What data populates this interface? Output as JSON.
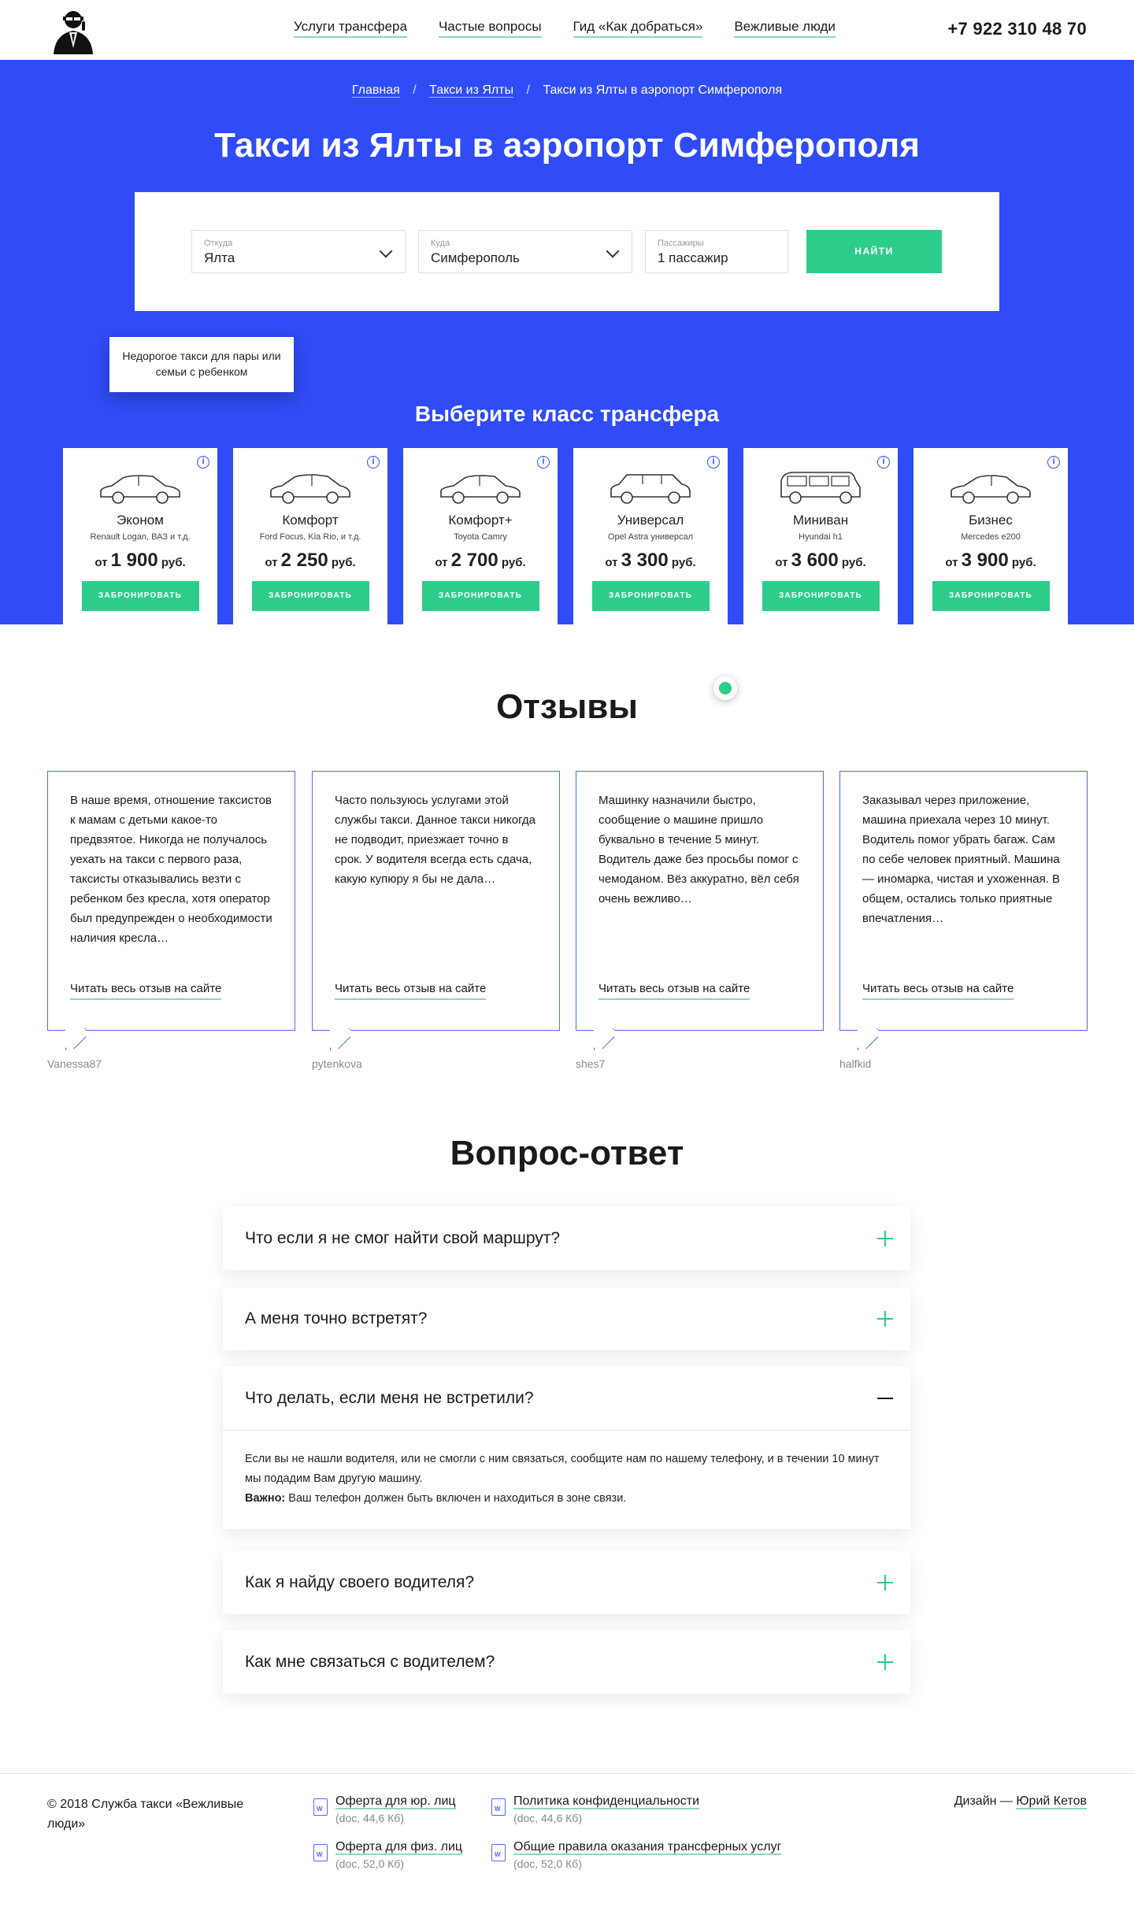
{
  "header": {
    "nav": [
      "Услуги трансфера",
      "Частые вопросы",
      "Гид «Как добраться»",
      "Вежливые люди"
    ],
    "phone": "+7 922 310 48 70"
  },
  "breadcrumbs": [
    "Главная",
    "Такси из Ялты",
    "Такси из Ялты в аэропорт Симферополя"
  ],
  "hero": {
    "title": "Такси из Ялты в аэропорт Симферополя",
    "from_label": "Откуда",
    "from_value": "Ялта",
    "to_label": "Куда",
    "to_value": "Симферополь",
    "pass_label": "Пассажиры",
    "pass_value": "1 пассажир",
    "find_button": "НАЙТИ"
  },
  "tooltip": "Недорогое такси для пары или семьи с ребенком",
  "classes_title": "Выберите класс трансфера",
  "classes": [
    {
      "name": "Эконом",
      "models": "Renault Logan, ВАЗ и т.д.",
      "price_prefix": "от",
      "price": "1 900",
      "currency": "руб.",
      "button": "ЗАБРОНИРОВАТЬ"
    },
    {
      "name": "Комфорт",
      "models": "Ford Focus, Kia Rio, и т.д.",
      "price_prefix": "от",
      "price": "2 250",
      "currency": "руб.",
      "button": "ЗАБРОНИРОВАТЬ"
    },
    {
      "name": "Комфорт+",
      "models": "Toyota Camry",
      "price_prefix": "от",
      "price": "2 700",
      "currency": "руб.",
      "button": "ЗАБРОНИРОВАТЬ"
    },
    {
      "name": "Универсал",
      "models": "Opel Astra универсал",
      "price_prefix": "от",
      "price": "3 300",
      "currency": "руб.",
      "button": "ЗАБРОНИРОВАТЬ"
    },
    {
      "name": "Миниван",
      "models": "Hyundai h1",
      "price_prefix": "от",
      "price": "3 600",
      "currency": "руб.",
      "button": "ЗАБРОНИРОВАТЬ"
    },
    {
      "name": "Бизнес",
      "models": "Mercedes e200",
      "price_prefix": "от",
      "price": "3 900",
      "currency": "руб.",
      "button": "ЗАБРОНИРОВАТЬ"
    }
  ],
  "reviews_title": "Отзывы",
  "reviews": [
    {
      "text": "В наше время, отношение таксистов к мамам с детьми какое-то предвзятое. Никогда не получалось уехать на такси с первого раза, таксисты отказывались везти с ребенком без кресла, хотя оператор был предупрежден о необходимости наличия кресла…",
      "more": "Читать весь отзыв на сайте",
      "author": "Vanessa87"
    },
    {
      "text": "Часто пользуюсь услугами этой службы такси. Данное такси никогда не подводит, приезжает точно в срок. У водителя всегда есть сдача, какую купюру я бы не дала…",
      "more": "Читать весь отзыв на сайте",
      "author": "pytenkova"
    },
    {
      "text": "Машинку назначили быстро, сообщение о машине пришло буквально в течение 5 минут. Водитель даже без просьбы помог с чемоданом. Вёз аккуратно, вёл себя очень вежливо…",
      "more": "Читать весь отзыв на сайте",
      "author": "shes7"
    },
    {
      "text": "Заказывал через приложение, машина приехала через 10 минут. Водитель помог убрать багаж. Сам по себе человек приятный. Машина — иномарка, чистая и ухоженная. В общем, остались только приятные впечатления…",
      "more": "Читать весь отзыв на сайте",
      "author": "halfkid"
    }
  ],
  "faq_title": "Вопрос-ответ",
  "faq": [
    {
      "q": "Что если я не смог найти свой маршрут?"
    },
    {
      "q": "А меня точно встретят?"
    },
    {
      "q": "Что делать, если меня не встретили?",
      "a": "Если вы не нашли водителя, или не смогли с ним связаться, сообщите нам по нашему телефону, и в течении 10 минут мы подадим Вам другую машину.",
      "note_label": "Важно:",
      "note": "Ваш телефон должен быть включен и находиться в зоне связи."
    },
    {
      "q": "Как я найду своего водителя?"
    },
    {
      "q": "Как мне связаться с водителем?"
    }
  ],
  "footer": {
    "copyright": "© 2018 Служба такси «Вежливые люди»",
    "docs": [
      {
        "title": "Оферта для юр. лиц",
        "meta": "(doc, 44,6 Кб)"
      },
      {
        "title": "Оферта для физ. лиц",
        "meta": "(doc, 52,0 Кб)"
      },
      {
        "title": "Политика конфиденциальности",
        "meta": "(doc, 44,6 Кб)"
      },
      {
        "title": "Общие правила оказания трансферных услуг",
        "meta": "(doc, 52,0 Кб)"
      }
    ],
    "design_prefix": "Дизайн —",
    "designer": "Юрий Кетов"
  },
  "colors": {
    "brand_blue": "#2f4cf6",
    "accent_green": "#2ecc8a"
  }
}
